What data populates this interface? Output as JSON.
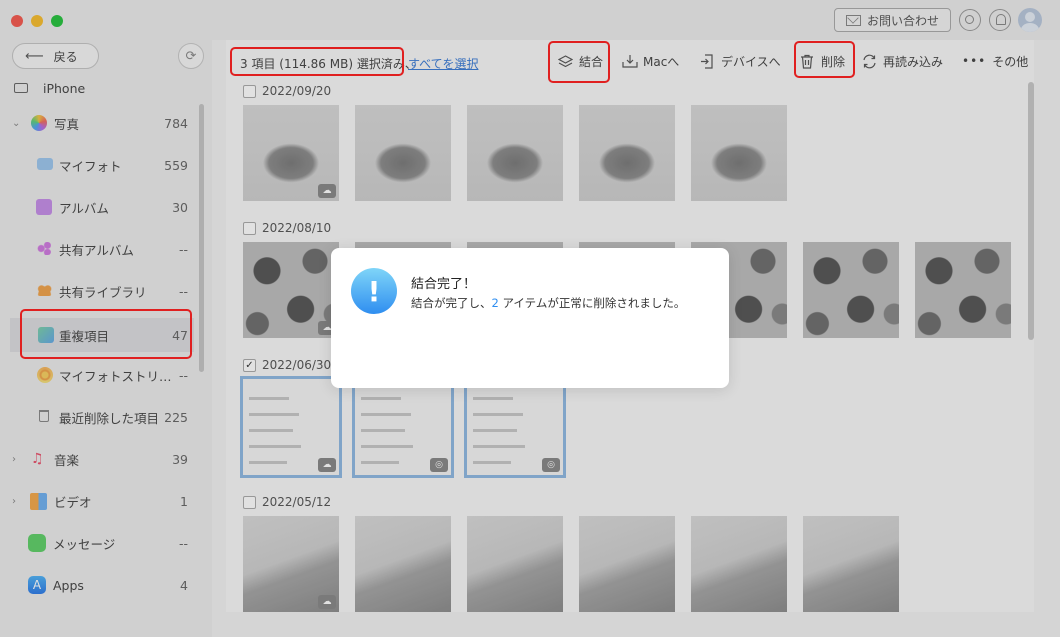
{
  "window": {
    "contact_label": "お問い合わせ"
  },
  "sidebar": {
    "back_label": "戻る",
    "device_name": "iPhone",
    "items": [
      {
        "label": "写真",
        "count": "784"
      },
      {
        "label": "マイフォト",
        "count": "559"
      },
      {
        "label": "アルバム",
        "count": "30"
      },
      {
        "label": "共有アルバム",
        "count": "--"
      },
      {
        "label": "共有ライブラリ",
        "count": "--"
      },
      {
        "label": "重複項目",
        "count": "47"
      },
      {
        "label": "マイフォトストリ…",
        "count": "--"
      },
      {
        "label": "最近削除した項目",
        "count": "225"
      },
      {
        "label": "音楽",
        "count": "39"
      },
      {
        "label": "ビデオ",
        "count": "1"
      },
      {
        "label": "メッセージ",
        "count": "--"
      },
      {
        "label": "Apps",
        "count": "4"
      }
    ]
  },
  "toolbar": {
    "selection_text": "3 項目 (114.86 MB) 選択済み、",
    "select_all_label": "すべてを選択",
    "merge_label": "結合",
    "to_mac_label": "Macへ",
    "to_device_label": "デバイスへ",
    "delete_label": "削除",
    "reload_label": "再読み込み",
    "more_label": "その他"
  },
  "groups": [
    {
      "date": "2022/09/20"
    },
    {
      "date": "2022/08/10"
    },
    {
      "date": "2022/06/30"
    },
    {
      "date": "2022/05/12"
    }
  ],
  "dialog": {
    "title": "結合完了！",
    "message_prefix": "結合が完了し、",
    "message_count": "2",
    "message_suffix": " アイテムが正常に削除されました。"
  },
  "colors": {
    "accent": "#2f8ef0",
    "highlight": "#e02020",
    "link": "#3a7bd5"
  }
}
